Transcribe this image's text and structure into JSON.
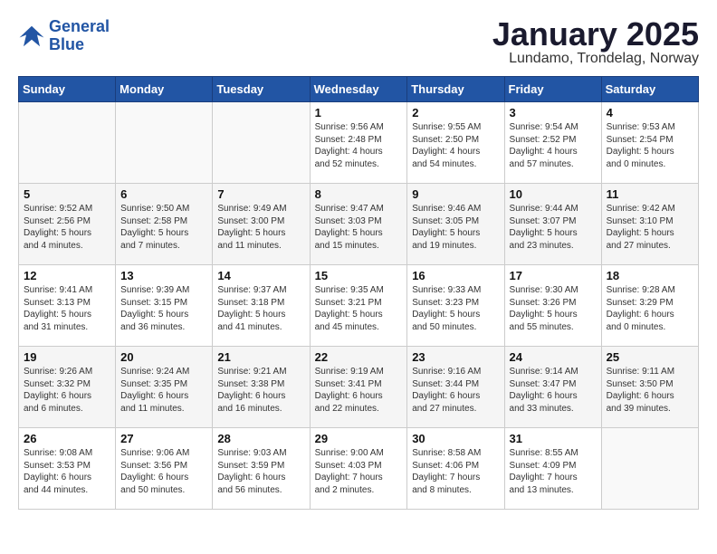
{
  "logo": {
    "line1": "General",
    "line2": "Blue"
  },
  "title": "January 2025",
  "subtitle": "Lundamo, Trondelag, Norway",
  "headers": [
    "Sunday",
    "Monday",
    "Tuesday",
    "Wednesday",
    "Thursday",
    "Friday",
    "Saturday"
  ],
  "weeks": [
    [
      {
        "num": "",
        "info": ""
      },
      {
        "num": "",
        "info": ""
      },
      {
        "num": "",
        "info": ""
      },
      {
        "num": "1",
        "info": "Sunrise: 9:56 AM\nSunset: 2:48 PM\nDaylight: 4 hours\nand 52 minutes."
      },
      {
        "num": "2",
        "info": "Sunrise: 9:55 AM\nSunset: 2:50 PM\nDaylight: 4 hours\nand 54 minutes."
      },
      {
        "num": "3",
        "info": "Sunrise: 9:54 AM\nSunset: 2:52 PM\nDaylight: 4 hours\nand 57 minutes."
      },
      {
        "num": "4",
        "info": "Sunrise: 9:53 AM\nSunset: 2:54 PM\nDaylight: 5 hours\nand 0 minutes."
      }
    ],
    [
      {
        "num": "5",
        "info": "Sunrise: 9:52 AM\nSunset: 2:56 PM\nDaylight: 5 hours\nand 4 minutes."
      },
      {
        "num": "6",
        "info": "Sunrise: 9:50 AM\nSunset: 2:58 PM\nDaylight: 5 hours\nand 7 minutes."
      },
      {
        "num": "7",
        "info": "Sunrise: 9:49 AM\nSunset: 3:00 PM\nDaylight: 5 hours\nand 11 minutes."
      },
      {
        "num": "8",
        "info": "Sunrise: 9:47 AM\nSunset: 3:03 PM\nDaylight: 5 hours\nand 15 minutes."
      },
      {
        "num": "9",
        "info": "Sunrise: 9:46 AM\nSunset: 3:05 PM\nDaylight: 5 hours\nand 19 minutes."
      },
      {
        "num": "10",
        "info": "Sunrise: 9:44 AM\nSunset: 3:07 PM\nDaylight: 5 hours\nand 23 minutes."
      },
      {
        "num": "11",
        "info": "Sunrise: 9:42 AM\nSunset: 3:10 PM\nDaylight: 5 hours\nand 27 minutes."
      }
    ],
    [
      {
        "num": "12",
        "info": "Sunrise: 9:41 AM\nSunset: 3:13 PM\nDaylight: 5 hours\nand 31 minutes."
      },
      {
        "num": "13",
        "info": "Sunrise: 9:39 AM\nSunset: 3:15 PM\nDaylight: 5 hours\nand 36 minutes."
      },
      {
        "num": "14",
        "info": "Sunrise: 9:37 AM\nSunset: 3:18 PM\nDaylight: 5 hours\nand 41 minutes."
      },
      {
        "num": "15",
        "info": "Sunrise: 9:35 AM\nSunset: 3:21 PM\nDaylight: 5 hours\nand 45 minutes."
      },
      {
        "num": "16",
        "info": "Sunrise: 9:33 AM\nSunset: 3:23 PM\nDaylight: 5 hours\nand 50 minutes."
      },
      {
        "num": "17",
        "info": "Sunrise: 9:30 AM\nSunset: 3:26 PM\nDaylight: 5 hours\nand 55 minutes."
      },
      {
        "num": "18",
        "info": "Sunrise: 9:28 AM\nSunset: 3:29 PM\nDaylight: 6 hours\nand 0 minutes."
      }
    ],
    [
      {
        "num": "19",
        "info": "Sunrise: 9:26 AM\nSunset: 3:32 PM\nDaylight: 6 hours\nand 6 minutes."
      },
      {
        "num": "20",
        "info": "Sunrise: 9:24 AM\nSunset: 3:35 PM\nDaylight: 6 hours\nand 11 minutes."
      },
      {
        "num": "21",
        "info": "Sunrise: 9:21 AM\nSunset: 3:38 PM\nDaylight: 6 hours\nand 16 minutes."
      },
      {
        "num": "22",
        "info": "Sunrise: 9:19 AM\nSunset: 3:41 PM\nDaylight: 6 hours\nand 22 minutes."
      },
      {
        "num": "23",
        "info": "Sunrise: 9:16 AM\nSunset: 3:44 PM\nDaylight: 6 hours\nand 27 minutes."
      },
      {
        "num": "24",
        "info": "Sunrise: 9:14 AM\nSunset: 3:47 PM\nDaylight: 6 hours\nand 33 minutes."
      },
      {
        "num": "25",
        "info": "Sunrise: 9:11 AM\nSunset: 3:50 PM\nDaylight: 6 hours\nand 39 minutes."
      }
    ],
    [
      {
        "num": "26",
        "info": "Sunrise: 9:08 AM\nSunset: 3:53 PM\nDaylight: 6 hours\nand 44 minutes."
      },
      {
        "num": "27",
        "info": "Sunrise: 9:06 AM\nSunset: 3:56 PM\nDaylight: 6 hours\nand 50 minutes."
      },
      {
        "num": "28",
        "info": "Sunrise: 9:03 AM\nSunset: 3:59 PM\nDaylight: 6 hours\nand 56 minutes."
      },
      {
        "num": "29",
        "info": "Sunrise: 9:00 AM\nSunset: 4:03 PM\nDaylight: 7 hours\nand 2 minutes."
      },
      {
        "num": "30",
        "info": "Sunrise: 8:58 AM\nSunset: 4:06 PM\nDaylight: 7 hours\nand 8 minutes."
      },
      {
        "num": "31",
        "info": "Sunrise: 8:55 AM\nSunset: 4:09 PM\nDaylight: 7 hours\nand 13 minutes."
      },
      {
        "num": "",
        "info": ""
      }
    ]
  ]
}
